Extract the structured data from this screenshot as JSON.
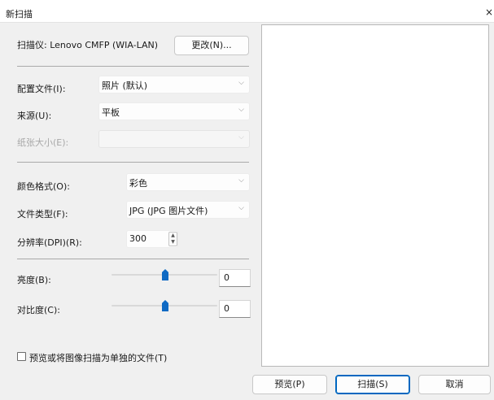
{
  "window": {
    "title": "新扫描",
    "close_glyph": "×"
  },
  "scanner": {
    "label": "扫描仪: Lenovo CMFP (WIA-LAN)",
    "change_button": "更改(N)..."
  },
  "profile": {
    "label": "配置文件(I):",
    "value": "照片 (默认)"
  },
  "source": {
    "label": "来源(U):",
    "value": "平板"
  },
  "paper_size": {
    "label": "纸张大小(E):",
    "value": ""
  },
  "color_format": {
    "label": "颜色格式(O):",
    "value": "彩色"
  },
  "file_type": {
    "label": "文件类型(F):",
    "value": "JPG (JPG 图片文件)"
  },
  "resolution": {
    "label": "分辨率(DPI)(R):",
    "value": "300"
  },
  "brightness": {
    "label": "亮度(B):",
    "value": "0"
  },
  "contrast": {
    "label": "对比度(C):",
    "value": "0"
  },
  "separate_files": {
    "label": "预览或将图像扫描为单独的文件(T)",
    "checked": false
  },
  "buttons": {
    "preview": "预览(P)",
    "scan": "扫描(S)",
    "cancel": "取消"
  },
  "icons": {
    "chevron": "⌵",
    "spin_up": "▲",
    "spin_down": "▼"
  },
  "colors": {
    "accent": "#0f6ac4",
    "focus_border": "#0067c0"
  }
}
